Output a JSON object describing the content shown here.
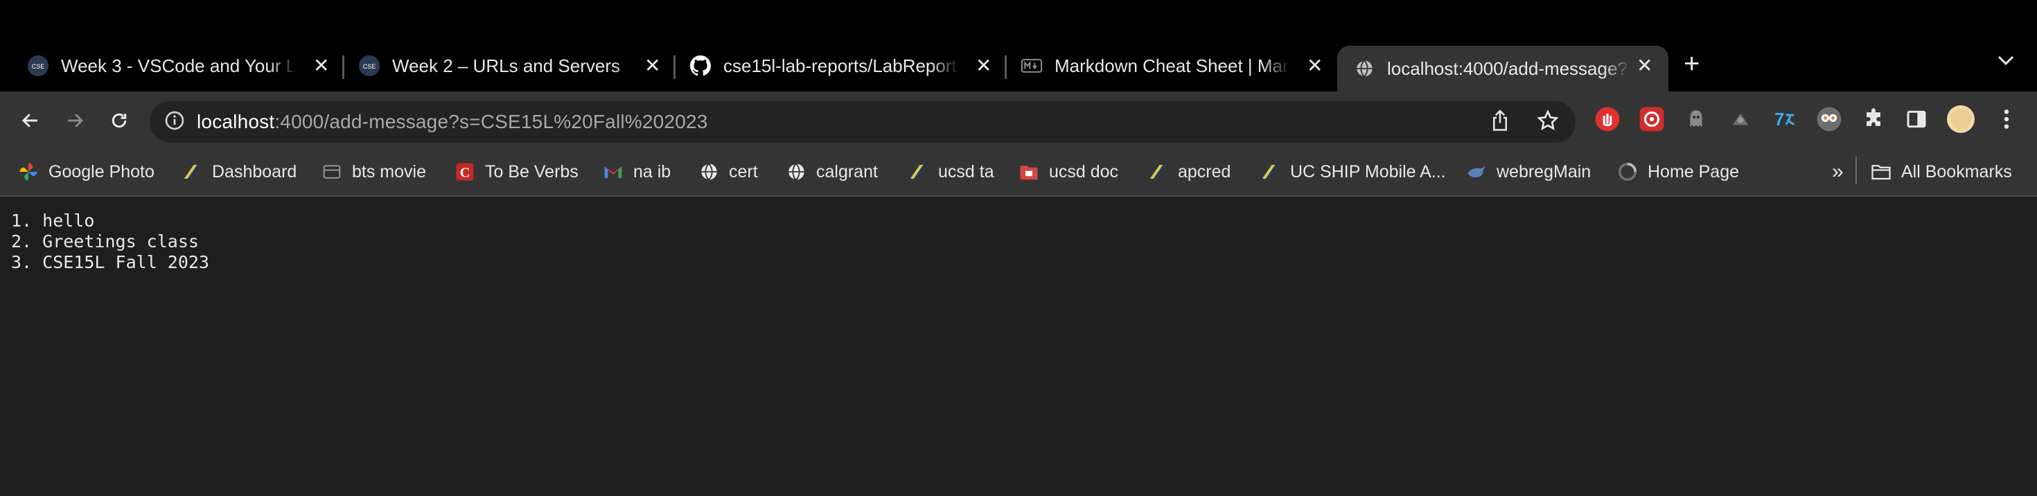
{
  "tabs": [
    {
      "title": "Week 3 - VSCode and Your Lo",
      "favicon": "cse-icon",
      "active": false
    },
    {
      "title": "Week 2 – URLs and Servers",
      "favicon": "cse-icon",
      "active": false
    },
    {
      "title": "cse15l-lab-reports/LabReport",
      "favicon": "github-icon",
      "active": false
    },
    {
      "title": "Markdown Cheat Sheet | Mark",
      "favicon": "markdown-icon",
      "active": false
    },
    {
      "title": "localhost:4000/add-message?",
      "favicon": "globe-icon",
      "active": true
    }
  ],
  "tab_close_glyph": "✕",
  "new_tab_glyph": "+",
  "address": {
    "host": "localhost",
    "rest": ":4000/add-message?s=CSE15L%20Fall%202023"
  },
  "bookmarks": [
    {
      "label": "Google Photo",
      "icon": "google-photos-icon"
    },
    {
      "label": "Dashboard",
      "icon": "dashboard-icon"
    },
    {
      "label": "bts movie",
      "icon": "film-icon"
    },
    {
      "label": "To Be Verbs",
      "icon": "c-logo-icon"
    },
    {
      "label": "na ib",
      "icon": "gmail-icon"
    },
    {
      "label": "cert",
      "icon": "globe-icon"
    },
    {
      "label": "calgrant",
      "icon": "globe-icon"
    },
    {
      "label": "ucsd ta",
      "icon": "ucsd-icon"
    },
    {
      "label": "ucsd doc",
      "icon": "folder-red-icon"
    },
    {
      "label": "apcred",
      "icon": "ucsd-icon"
    },
    {
      "label": "UC SHIP Mobile A...",
      "icon": "ucsd-icon"
    },
    {
      "label": "webregMain",
      "icon": "webreg-icon"
    },
    {
      "label": "Home Page",
      "icon": "loading-icon"
    }
  ],
  "more_bookmarks_glyph": "»",
  "all_bookmarks_label": "All Bookmarks",
  "messages": [
    "1. hello",
    "2. Greetings class",
    "3. CSE15L Fall 2023"
  ],
  "colors": {
    "background": "#1e1e1e",
    "toolbar": "#343434",
    "tabstrip": "#000000"
  }
}
